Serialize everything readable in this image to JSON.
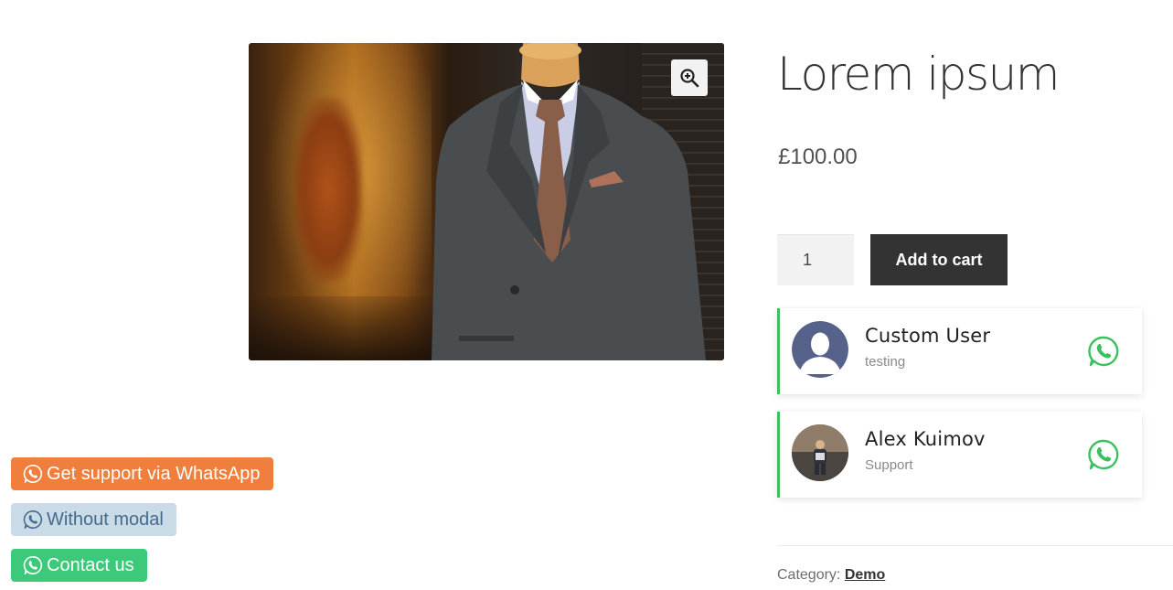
{
  "product": {
    "title": "Lorem ipsum",
    "price": "£100.00",
    "quantity": "1",
    "add_to_cart_label": "Add to cart",
    "category_label": "Category:",
    "category_value": "Demo",
    "image_alt": "Suit on mannequin"
  },
  "agents": [
    {
      "name": "Custom User",
      "role": "testing",
      "avatar": "default-avatar-icon"
    },
    {
      "name": "Alex Kuimov",
      "role": "Support",
      "avatar": "photo-avatar"
    }
  ],
  "whatsapp_buttons": [
    {
      "label": "Get support via WhatsApp",
      "color": "#f07e3d"
    },
    {
      "label": "Without modal",
      "color": "#c8dbe7"
    },
    {
      "label": "Contact us",
      "color": "#3dc97a"
    }
  ],
  "colors": {
    "accent_green": "#3ac15e",
    "button_dark": "#333333"
  }
}
